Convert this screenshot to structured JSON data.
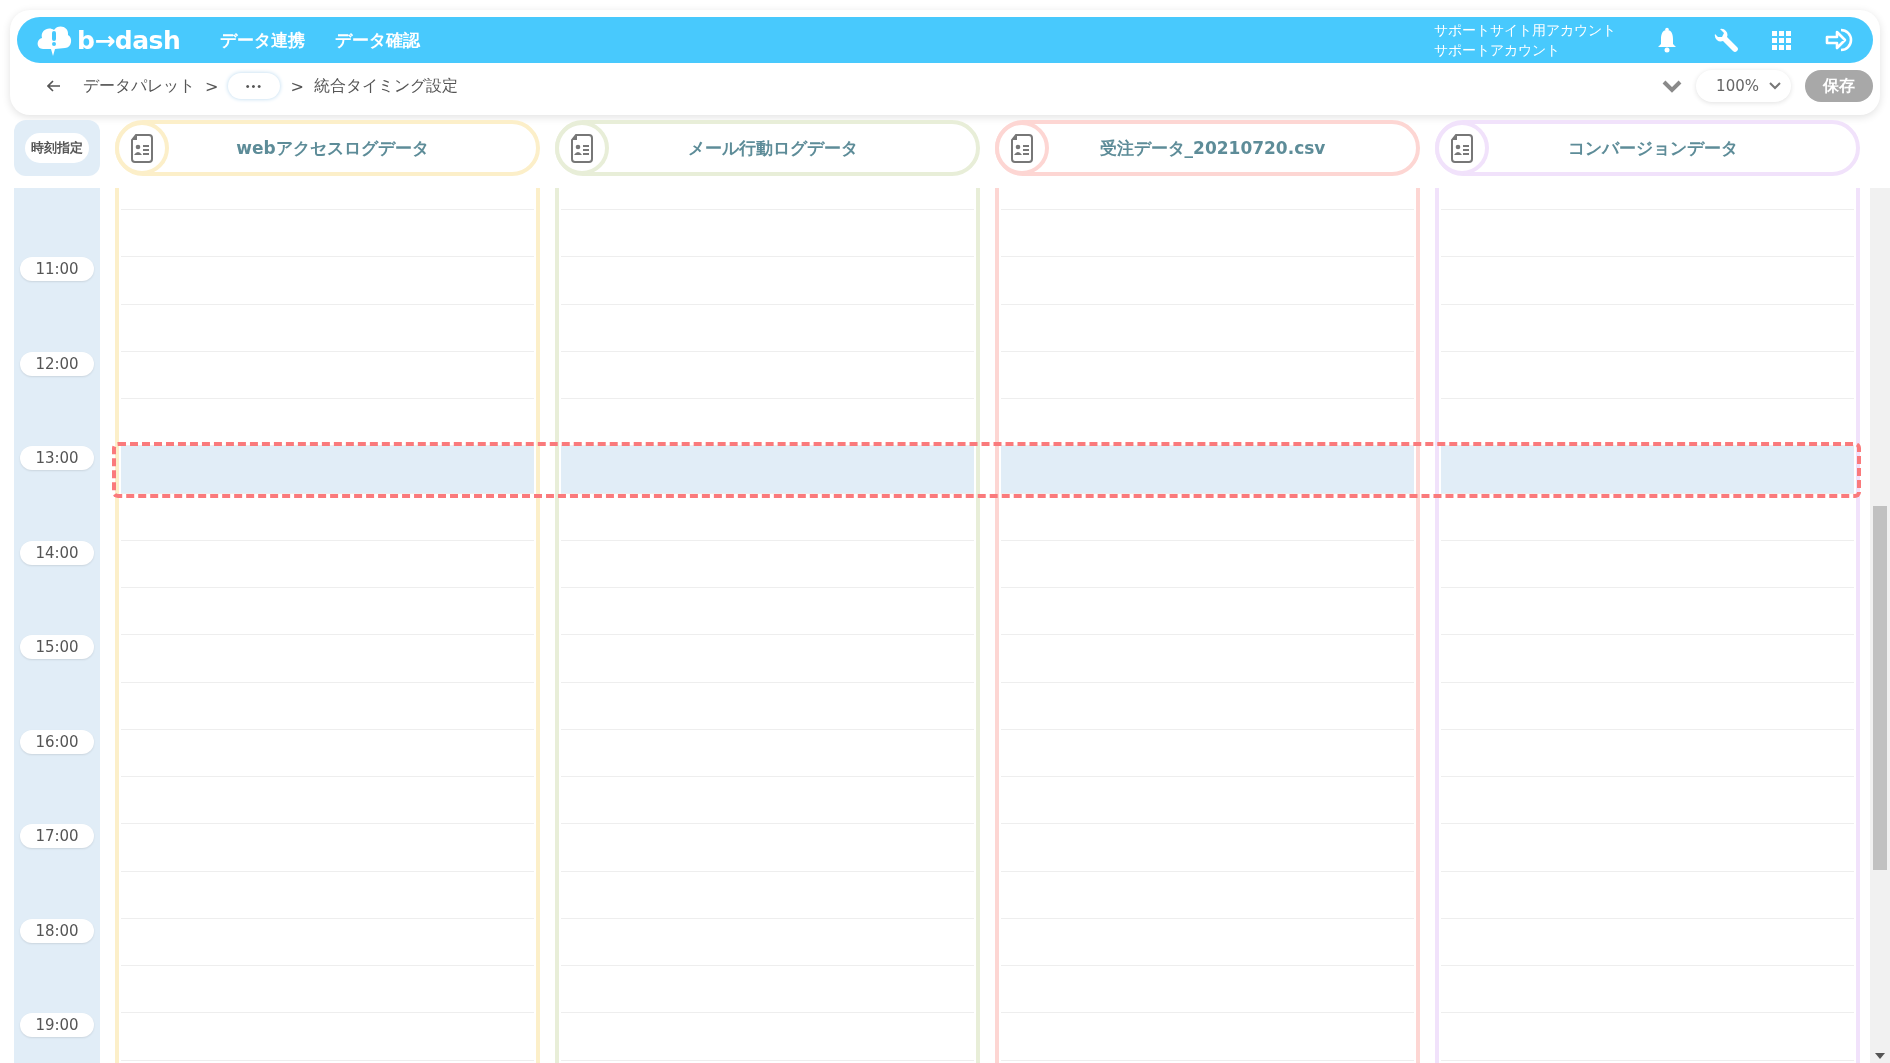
{
  "header": {
    "logo": "b→dash",
    "nav": [
      "データ連携",
      "データ確認"
    ],
    "account": [
      "サポートサイト用アカウント",
      "サポートアカウント"
    ]
  },
  "breadcrumb": {
    "items": [
      {
        "kind": "link",
        "text": "データパレット"
      },
      {
        "kind": "sep",
        "text": ">"
      },
      {
        "kind": "more",
        "text": "•••"
      },
      {
        "kind": "sep",
        "text": ">"
      },
      {
        "kind": "current",
        "text": "統合タイミング設定"
      }
    ]
  },
  "toolbar": {
    "zoom": "100%",
    "save": {
      "label": "保存",
      "disabled": true
    }
  },
  "time_header": "時刻指定",
  "sources": [
    {
      "name": "webアクセスログデータ",
      "color": "#fcefc9"
    },
    {
      "name": "メール行動ログデータ",
      "color": "#e8eed8"
    },
    {
      "name": "受注データ_20210720.csv",
      "color": "#fdd6d3"
    },
    {
      "name": "コンバージョンデータ",
      "color": "#f1e2fb"
    }
  ],
  "hours": [
    {
      "label": "11:00",
      "selected": false
    },
    {
      "label": "12:00",
      "selected": false
    },
    {
      "label": "13:00",
      "selected": true
    },
    {
      "label": "14:00",
      "selected": false
    },
    {
      "label": "15:00",
      "selected": false
    },
    {
      "label": "16:00",
      "selected": false
    },
    {
      "label": "17:00",
      "selected": false
    },
    {
      "label": "18:00",
      "selected": false
    },
    {
      "label": "19:00",
      "selected": false
    }
  ]
}
